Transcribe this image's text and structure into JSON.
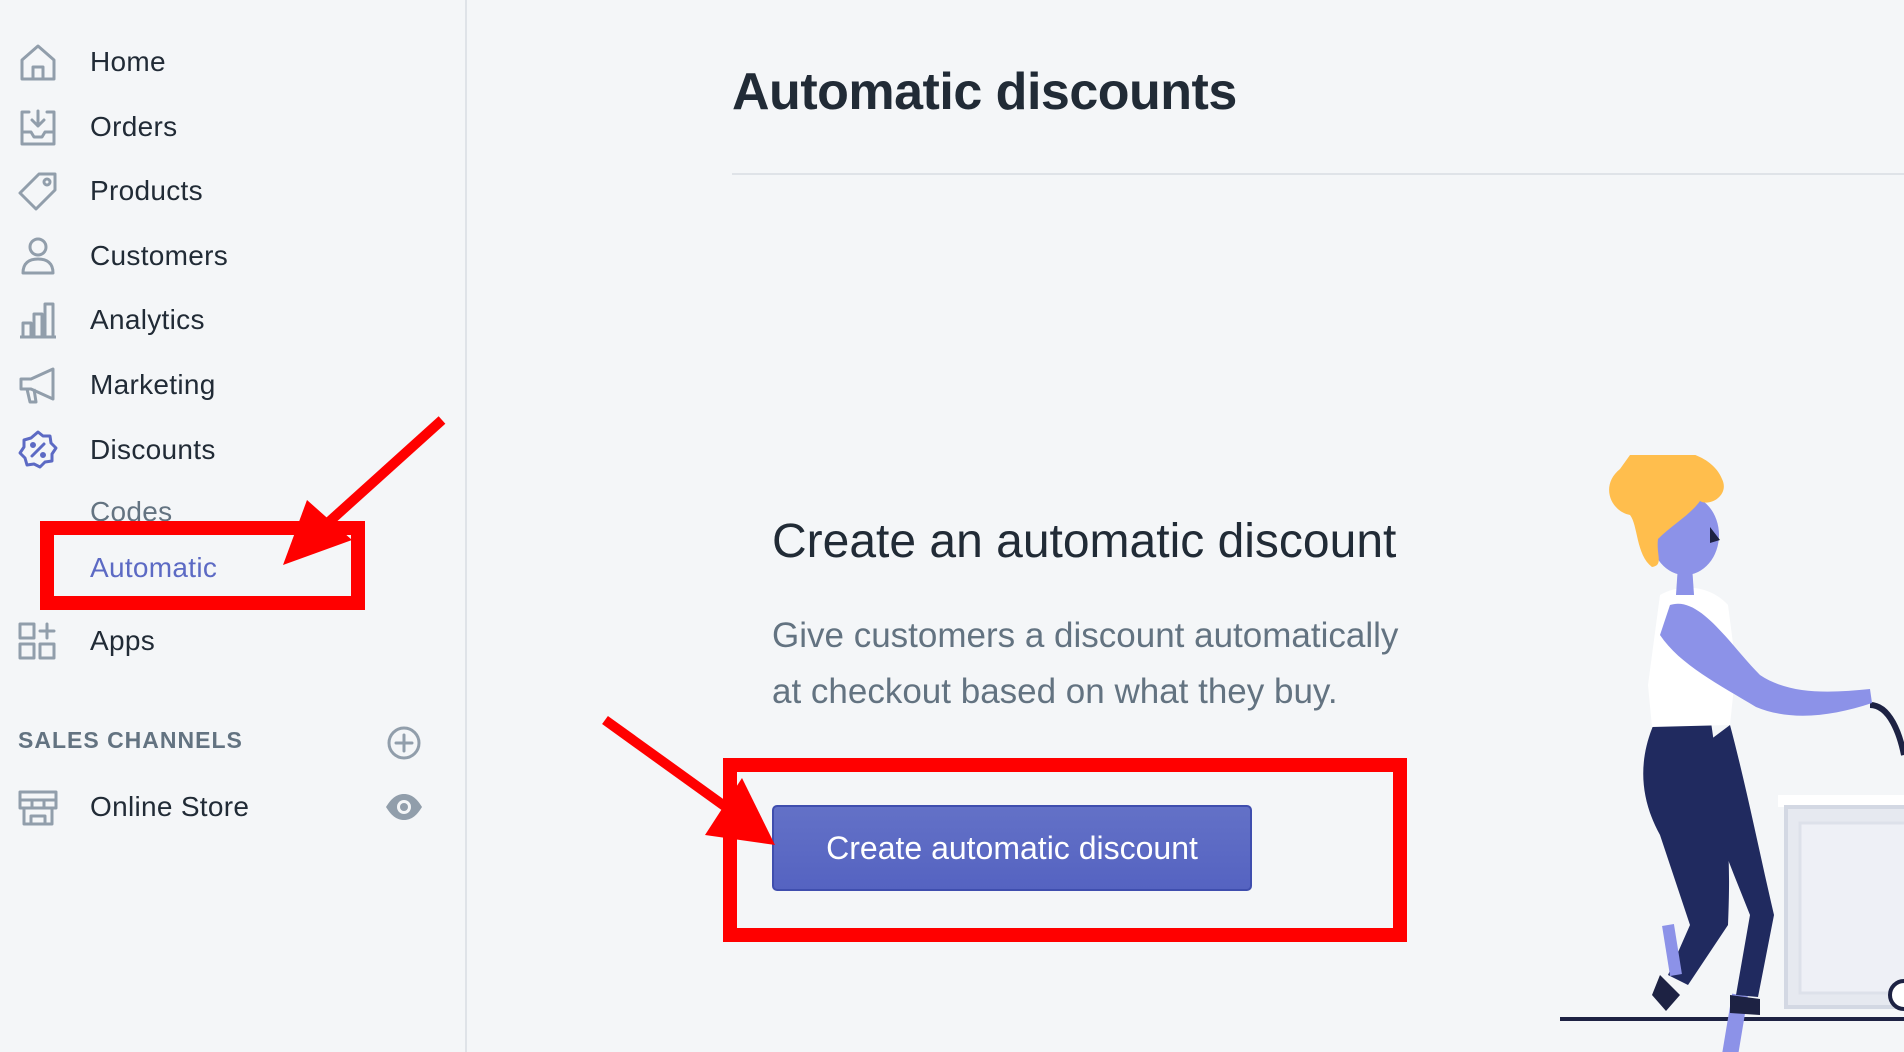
{
  "sidebar": {
    "items": [
      {
        "label": "Home",
        "icon": "home-icon"
      },
      {
        "label": "Orders",
        "icon": "orders-icon"
      },
      {
        "label": "Products",
        "icon": "tag-icon"
      },
      {
        "label": "Customers",
        "icon": "person-icon"
      },
      {
        "label": "Analytics",
        "icon": "bar-chart-icon"
      },
      {
        "label": "Marketing",
        "icon": "megaphone-icon"
      },
      {
        "label": "Discounts",
        "icon": "discount-badge-icon",
        "active": true
      },
      {
        "label": "Apps",
        "icon": "apps-grid-icon"
      }
    ],
    "discount_subitems": [
      {
        "label": "Codes",
        "selected": false
      },
      {
        "label": "Automatic",
        "selected": true
      }
    ],
    "sales_channels": {
      "title": "SALES CHANNELS",
      "add_icon": "plus-circle-icon",
      "items": [
        {
          "label": "Online Store",
          "icon": "store-icon",
          "action_icon": "eye-icon"
        }
      ]
    }
  },
  "main": {
    "title": "Automatic discounts",
    "empty_state": {
      "heading": "Create an automatic discount",
      "description": "Give customers a discount automatically at checkout based on what they buy.",
      "button_label": "Create automatic discount"
    }
  },
  "colors": {
    "accent": "#5c6ac4",
    "annotation": "#ff0000",
    "text": "#212b36",
    "subdued": "#637381",
    "background": "#f4f6f8"
  }
}
